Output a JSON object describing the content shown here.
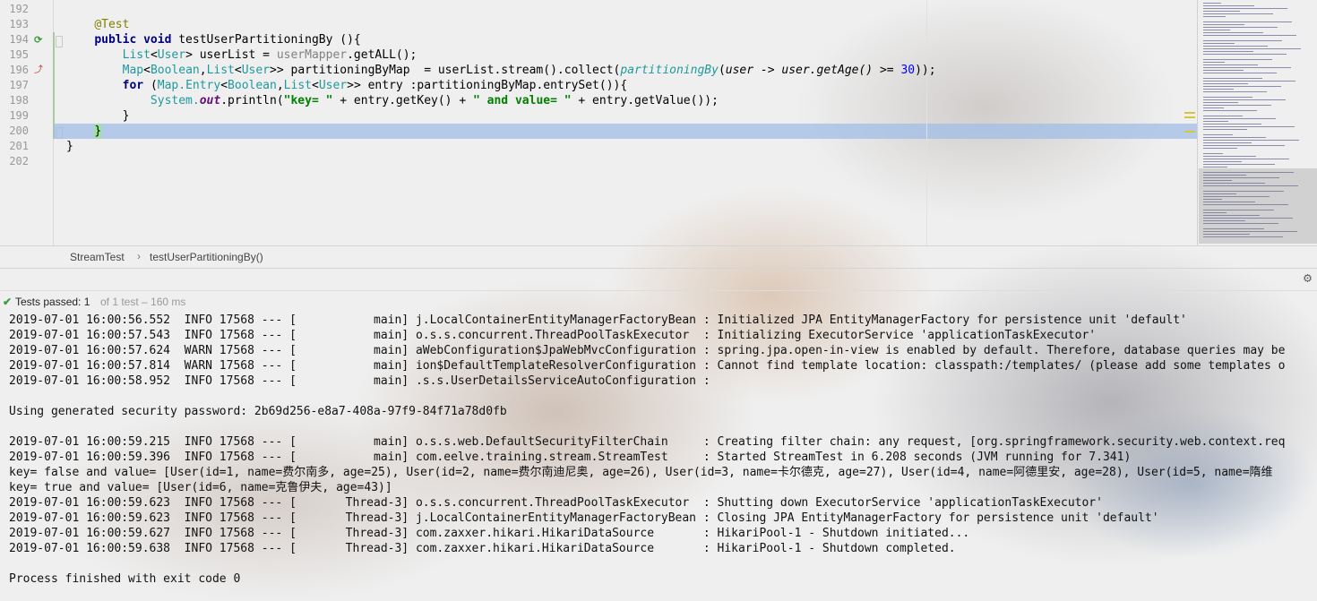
{
  "editor": {
    "line_numbers": [
      "192",
      "193",
      "194",
      "195",
      "196",
      "197",
      "198",
      "199",
      "200",
      "201",
      "202"
    ],
    "code_lines": [
      [
        {
          "t": "",
          "c": ""
        }
      ],
      [
        {
          "t": "    ",
          "c": ""
        },
        {
          "t": "@Test",
          "c": "ann"
        }
      ],
      [
        {
          "t": "    ",
          "c": ""
        },
        {
          "t": "public void ",
          "c": "kw"
        },
        {
          "t": "testUserPartitioningBy ",
          "c": "fn"
        },
        {
          "t": "(){",
          "c": ""
        }
      ],
      [
        {
          "t": "        ",
          "c": ""
        },
        {
          "t": "List",
          "c": "typ"
        },
        {
          "t": "<",
          "c": ""
        },
        {
          "t": "User",
          "c": "typ"
        },
        {
          "t": "> ",
          "c": ""
        },
        {
          "t": "userList = ",
          "c": "fn"
        },
        {
          "t": "userMapper",
          "c": "gray"
        },
        {
          "t": ".getALL();",
          "c": "fn"
        }
      ],
      [
        {
          "t": "        ",
          "c": ""
        },
        {
          "t": "Map",
          "c": "typ"
        },
        {
          "t": "<",
          "c": ""
        },
        {
          "t": "Boolean",
          "c": "typ"
        },
        {
          "t": ",",
          "c": ""
        },
        {
          "t": "List",
          "c": "typ"
        },
        {
          "t": "<",
          "c": ""
        },
        {
          "t": "User",
          "c": "typ"
        },
        {
          "t": ">> ",
          "c": ""
        },
        {
          "t": "partitioningByMap  = userList.stream().collect(",
          "c": "fn"
        },
        {
          "t": "partitioningBy",
          "c": "typ it"
        },
        {
          "t": "(",
          "c": ""
        },
        {
          "t": "user -> user.getAge() ",
          "c": "it"
        },
        {
          "t": ">= ",
          "c": ""
        },
        {
          "t": "30",
          "c": "num"
        },
        {
          "t": "));",
          "c": ""
        }
      ],
      [
        {
          "t": "        ",
          "c": ""
        },
        {
          "t": "for ",
          "c": "kw"
        },
        {
          "t": "(",
          "c": ""
        },
        {
          "t": "Map.Entry",
          "c": "typ"
        },
        {
          "t": "<",
          "c": ""
        },
        {
          "t": "Boolean",
          "c": "typ"
        },
        {
          "t": ",",
          "c": ""
        },
        {
          "t": "List",
          "c": "typ"
        },
        {
          "t": "<",
          "c": ""
        },
        {
          "t": "User",
          "c": "typ"
        },
        {
          "t": ">> entry :partitioningByMap.entrySet()){",
          "c": ""
        }
      ],
      [
        {
          "t": "            ",
          "c": ""
        },
        {
          "t": "System.",
          "c": "typ"
        },
        {
          "t": "out",
          "c": "stat"
        },
        {
          "t": ".println(",
          "c": ""
        },
        {
          "t": "\"key= \"",
          "c": "str"
        },
        {
          "t": " + entry.getKey() + ",
          "c": ""
        },
        {
          "t": "\" and value= \"",
          "c": "str"
        },
        {
          "t": " + entry.getValue());",
          "c": ""
        }
      ],
      [
        {
          "t": "        }",
          "c": ""
        }
      ],
      [
        {
          "t": "    ",
          "c": ""
        },
        {
          "t": "}",
          "c": "brace-hi"
        }
      ],
      [
        {
          "t": "}",
          "c": ""
        }
      ],
      [
        {
          "t": "",
          "c": ""
        }
      ]
    ]
  },
  "breadcrumb": {
    "class_name": "StreamTest",
    "separator": "›",
    "method_name": "testUserPartitioningBy()"
  },
  "run": {
    "status_main": "Tests passed: 1",
    "status_sub": "of 1 test – 160 ms",
    "console_lines": [
      "2019-07-01 16:00:56.552  INFO 17568 --- [           main] j.LocalContainerEntityManagerFactoryBean : Initialized JPA EntityManagerFactory for persistence unit 'default'",
      "2019-07-01 16:00:57.543  INFO 17568 --- [           main] o.s.s.concurrent.ThreadPoolTaskExecutor  : Initializing ExecutorService 'applicationTaskExecutor'",
      "2019-07-01 16:00:57.624  WARN 17568 --- [           main] aWebConfiguration$JpaWebMvcConfiguration : spring.jpa.open-in-view is enabled by default. Therefore, database queries may be",
      "2019-07-01 16:00:57.814  WARN 17568 --- [           main] ion$DefaultTemplateResolverConfiguration : Cannot find template location: classpath:/templates/ (please add some templates o",
      "2019-07-01 16:00:58.952  INFO 17568 --- [           main] .s.s.UserDetailsServiceAutoConfiguration :",
      "",
      "Using generated security password: 2b69d256-e8a7-408a-97f9-84f71a78d0fb",
      "",
      "2019-07-01 16:00:59.215  INFO 17568 --- [           main] o.s.s.web.DefaultSecurityFilterChain     : Creating filter chain: any request, [org.springframework.security.web.context.req",
      "2019-07-01 16:00:59.396  INFO 17568 --- [           main] com.eelve.training.stream.StreamTest     : Started StreamTest in 6.208 seconds (JVM running for 7.341)",
      "key= false and value= [User(id=1, name=费尔南多, age=25), User(id=2, name=费尔南迪尼奥, age=26), User(id=3, name=卡尔德克, age=27), User(id=4, name=阿德里安, age=28), User(id=5, name=隋维",
      "key= true and value= [User(id=6, name=克鲁伊夫, age=43)]",
      "2019-07-01 16:00:59.623  INFO 17568 --- [       Thread-3] o.s.s.concurrent.ThreadPoolTaskExecutor  : Shutting down ExecutorService 'applicationTaskExecutor'",
      "2019-07-01 16:00:59.623  INFO 17568 --- [       Thread-3] j.LocalContainerEntityManagerFactoryBean : Closing JPA EntityManagerFactory for persistence unit 'default'",
      "2019-07-01 16:00:59.627  INFO 17568 --- [       Thread-3] com.zaxxer.hikari.HikariDataSource       : HikariPool-1 - Shutdown initiated...",
      "2019-07-01 16:00:59.638  INFO 17568 --- [       Thread-3] com.zaxxer.hikari.HikariDataSource       : HikariPool-1 - Shutdown completed.",
      "",
      "Process finished with exit code 0"
    ]
  },
  "icons": {
    "run_test": "run-test-icon",
    "test_failed_marker": "test-marker-icon",
    "settings": "gear-icon",
    "passed": "check-icon"
  },
  "colors": {
    "current_line": "#a0bee6",
    "keyword": "#000080",
    "string": "#008000",
    "annotation": "#808000",
    "type": "#20999d",
    "passed": "#3e9a3e"
  }
}
